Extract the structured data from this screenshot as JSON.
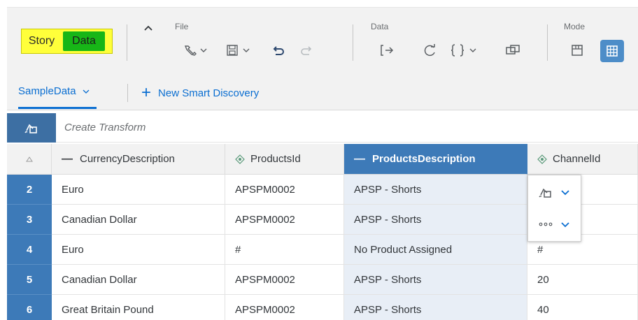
{
  "mode_switch": {
    "story": "Story",
    "data": "Data"
  },
  "toolbar": {
    "file_label": "File",
    "data_label": "Data",
    "mode_label": "Mode",
    "icons": [
      "wrench-icon",
      "save-icon",
      "undo-icon",
      "redo-icon",
      "import-icon",
      "refresh-icon",
      "formula-icon",
      "copy-icon",
      "blueprint-icon",
      "grid-icon"
    ]
  },
  "tabs": {
    "active": "SampleData",
    "new_discovery": "New Smart Discovery"
  },
  "transform": {
    "placeholder": "Create Transform"
  },
  "grid": {
    "columns": [
      {
        "label": "CurrencyDescription",
        "marker": "—"
      },
      {
        "label": "ProductsId",
        "marker": "diamond"
      },
      {
        "label": "ProductsDescription",
        "marker": "—",
        "selected": true
      },
      {
        "label": "ChannelId",
        "marker": "diamond"
      }
    ],
    "rows": [
      {
        "num": "2",
        "cells": [
          "Euro",
          "APSPM0002",
          "APSP - Shorts",
          ""
        ]
      },
      {
        "num": "3",
        "cells": [
          "Canadian Dollar",
          "APSPM0002",
          "APSP - Shorts",
          ""
        ]
      },
      {
        "num": "4",
        "cells": [
          "Euro",
          "#",
          "No Product Assigned",
          "#"
        ]
      },
      {
        "num": "5",
        "cells": [
          "Canadian Dollar",
          "APSPM0002",
          "APSP - Shorts",
          "20"
        ]
      },
      {
        "num": "6",
        "cells": [
          "Great Britain Pound",
          "APSPM0002",
          "APSP - Shorts",
          "40"
        ]
      }
    ]
  },
  "colors": {
    "accent": "#0a6ed1",
    "header_selected": "#3d7ab8",
    "story_highlight": "#ffff3a",
    "data_button": "#17b617"
  }
}
